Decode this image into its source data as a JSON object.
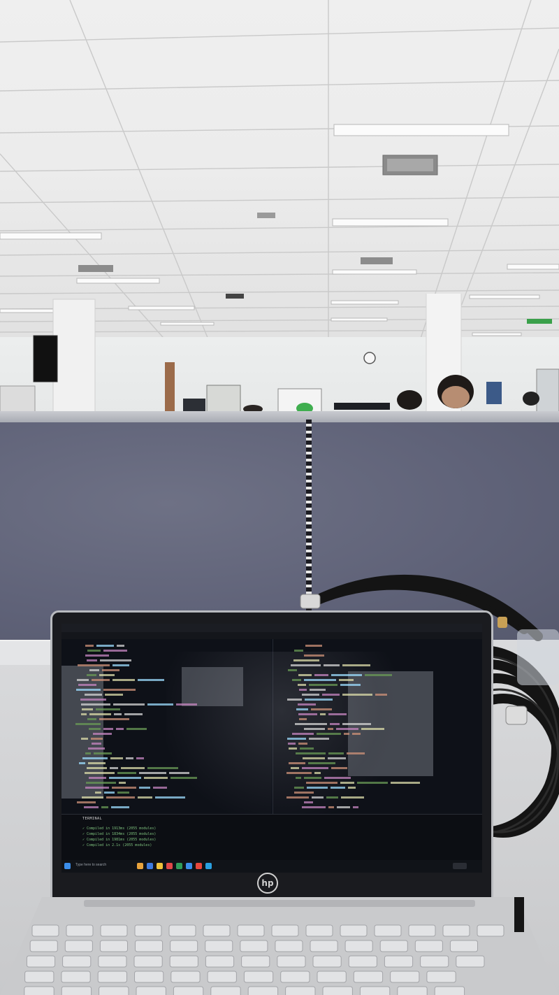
{
  "scene": {
    "description_kind": "photo",
    "laptop_brand_logo": "hp",
    "screen": {
      "search_placeholder": "Type here to search",
      "terminal_lines": [
        "✓ Compiled in 1913ms (2055 modules)",
        "✓ Compiled in 1834ms (2055 modules)",
        "✓ Compiled in 1981ms (2055 modules)",
        "✓ Compiled in 2.1s (2055 modules)"
      ],
      "terminal_tab": "TERMINAL",
      "palette": {
        "accent_blue": "#3b8eea",
        "keyword": "#c586c0",
        "string": "#ce9178",
        "function": "#dcdcaa",
        "variable": "#9cdcfe",
        "green": "#6a9955"
      }
    },
    "colors": {
      "ceiling": "#ececec",
      "partition": "#5f6278",
      "desk": "#cfd0d2",
      "cable": "#1a1a1a"
    }
  }
}
